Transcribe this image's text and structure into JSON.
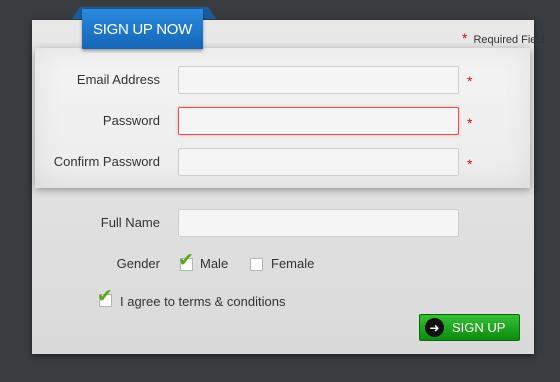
{
  "tab": {
    "label": "SIGN UP NOW"
  },
  "required_note": {
    "star": "*",
    "text": "Required Field"
  },
  "fields": {
    "email": {
      "label": "Email Address",
      "value": "",
      "star": "*"
    },
    "password": {
      "label": "Password",
      "value": "",
      "star": "*"
    },
    "confirm": {
      "label": "Confirm Password",
      "value": "",
      "star": "*"
    },
    "fullname": {
      "label": "Full Name",
      "value": ""
    }
  },
  "gender": {
    "label": "Gender",
    "options": [
      {
        "label": "Male",
        "checked": true
      },
      {
        "label": "Female",
        "checked": false
      }
    ]
  },
  "terms": {
    "label": "I agree to terms & conditions",
    "checked": true
  },
  "submit": {
    "label": "SIGN UP",
    "icon": "arrow-right-icon"
  },
  "colors": {
    "tab": "#1b74cc",
    "button": "#1fa21f",
    "required": "#cc1111",
    "check": "#5aa81e"
  }
}
